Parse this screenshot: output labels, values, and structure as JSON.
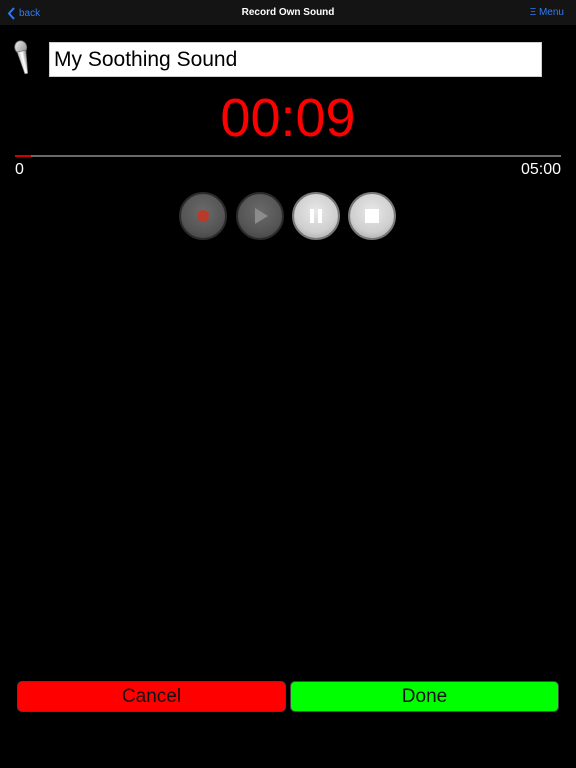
{
  "navbar": {
    "back_label": "back",
    "title": "Record Own Sound",
    "menu_label": "Ξ Menu"
  },
  "recording": {
    "name_value": "My Soothing Sound",
    "elapsed": "00:09",
    "start_label": "0",
    "max_label": "05:00",
    "progress_fraction": 0.03
  },
  "controls": [
    "record-icon",
    "play-icon",
    "pause-icon",
    "stop-icon"
  ],
  "actions": {
    "cancel_label": "Cancel",
    "done_label": "Done"
  },
  "colors": {
    "accent": "#2f7cf6",
    "timer": "#ff0000",
    "cancel": "#ff0000",
    "done": "#00ff00"
  }
}
